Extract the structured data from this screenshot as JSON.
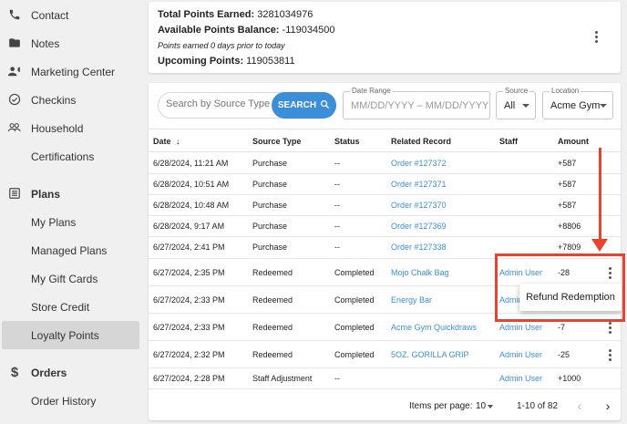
{
  "sidebar": {
    "items": [
      {
        "label": "Contact",
        "icon": "phone-icon"
      },
      {
        "label": "Notes",
        "icon": "folder-icon"
      },
      {
        "label": "Marketing Center",
        "icon": "megaphone-person-icon"
      },
      {
        "label": "Checkins",
        "icon": "check-circle-icon"
      },
      {
        "label": "Household",
        "icon": "people-icon"
      },
      {
        "label": "Certifications",
        "icon": ""
      },
      {
        "label": "Plans",
        "icon": "list-icon"
      },
      {
        "label": "My Plans",
        "icon": ""
      },
      {
        "label": "Managed Plans",
        "icon": ""
      },
      {
        "label": "My Gift Cards",
        "icon": ""
      },
      {
        "label": "Store Credit",
        "icon": ""
      },
      {
        "label": "Loyalty Points",
        "icon": ""
      },
      {
        "label": "Orders",
        "icon": "dollar-icon"
      },
      {
        "label": "Order History",
        "icon": ""
      }
    ]
  },
  "summary": {
    "total_label": "Total Points Earned:",
    "total_value": "3281034976",
    "available_label": "Available Points Balance:",
    "available_value": "-119034500",
    "note": "Points earned 0 days prior to today",
    "upcoming_label": "Upcoming Points:",
    "upcoming_value": "119053811"
  },
  "filters": {
    "search_placeholder": "Search by Source Type or",
    "search_button": "SEARCH",
    "date_range_label": "Date Range",
    "date_range_placeholder": "MM/DD/YYYY – MM/DD/YYYY",
    "source_label": "Source",
    "source_value": "All",
    "location_label": "Location",
    "location_value": "Acme Gym"
  },
  "table": {
    "headers": {
      "date": "Date",
      "source_type": "Source Type",
      "status": "Status",
      "related_record": "Related Record",
      "staff": "Staff",
      "amount": "Amount"
    },
    "rows": [
      {
        "date": "6/28/2024, 11:21 AM",
        "source_type": "Purchase",
        "status": "--",
        "related_record": "Order #127372",
        "staff": "",
        "amount": "+587"
      },
      {
        "date": "6/28/2024, 10:51 AM",
        "source_type": "Purchase",
        "status": "--",
        "related_record": "Order #127371",
        "staff": "",
        "amount": "+587"
      },
      {
        "date": "6/28/2024, 10:48 AM",
        "source_type": "Purchase",
        "status": "--",
        "related_record": "Order #127370",
        "staff": "",
        "amount": "+587"
      },
      {
        "date": "6/28/2024, 9:17 AM",
        "source_type": "Purchase",
        "status": "--",
        "related_record": "Order #127369",
        "staff": "",
        "amount": "+8806"
      },
      {
        "date": "6/27/2024, 2:41 PM",
        "source_type": "Purchase",
        "status": "--",
        "related_record": "Order #127338",
        "staff": "",
        "amount": "+7809"
      },
      {
        "date": "6/27/2024, 2:35 PM",
        "source_type": "Redeemed",
        "status": "Completed",
        "related_record": "Mojo Chalk Bag",
        "staff": "Admin User",
        "amount": "-28"
      },
      {
        "date": "6/27/2024, 2:33 PM",
        "source_type": "Redeemed",
        "status": "Completed",
        "related_record": "Energy Bar",
        "staff": "Admin",
        "amount": ""
      },
      {
        "date": "6/27/2024, 2:33 PM",
        "source_type": "Redeemed",
        "status": "Completed",
        "related_record": "Acme Gym Quickdraws",
        "staff": "Admin User",
        "amount": "-7"
      },
      {
        "date": "6/27/2024, 2:32 PM",
        "source_type": "Redeemed",
        "status": "Completed",
        "related_record": "5OZ. GORILLA GRIP",
        "staff": "Admin User",
        "amount": "-25"
      },
      {
        "date": "6/27/2024, 2:28 PM",
        "source_type": "Staff Adjustment",
        "status": "--",
        "related_record": "",
        "staff": "Admin User",
        "amount": "+1000"
      }
    ]
  },
  "pagination": {
    "items_per_page_label": "Items per page:",
    "items_per_page_value": "10",
    "range": "1-10 of 82"
  },
  "menu": {
    "refund_redemption": "Refund Redemption"
  },
  "colors": {
    "link": "#3b8fd9",
    "annotation": "#e8432d",
    "active_nav": "#d6d6d6"
  }
}
